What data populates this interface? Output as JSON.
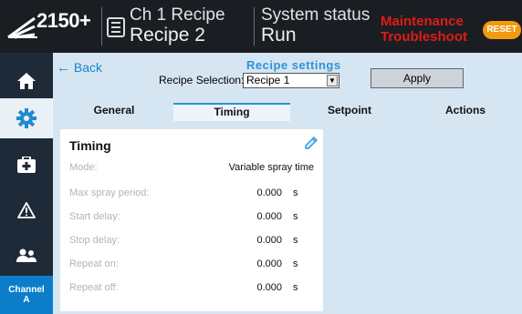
{
  "header": {
    "model": "2150+",
    "recipe_line1": "Ch 1 Recipe",
    "recipe_line2": "Recipe 2",
    "status_line1": "System status",
    "status_line2": "Run",
    "alert_line1": "Maintenance",
    "alert_line2": "Troubleshoot",
    "reset_label": "RESET",
    "alert_color": "#e01c17",
    "reset_color": "#f29a11"
  },
  "sidebar": {
    "items": [
      {
        "name": "home",
        "icon": "home-icon"
      },
      {
        "name": "settings",
        "icon": "gear-icon",
        "active": true
      },
      {
        "name": "maintenance",
        "icon": "first-aid-kit-icon"
      },
      {
        "name": "alarms",
        "icon": "warning-icon"
      },
      {
        "name": "users",
        "icon": "users-icon"
      }
    ],
    "channel_line1": "Channel",
    "channel_line2": "A"
  },
  "page": {
    "back_label": "Back",
    "title": "Recipe settings",
    "recipe_selection_label": "Recipe Selection:",
    "recipe_selection_value": "Recipe 1",
    "apply_label": "Apply"
  },
  "tabs": [
    "General",
    "Timing",
    "Setpoint",
    "Actions"
  ],
  "active_tab": "Timing",
  "card": {
    "title": "Timing",
    "rows": [
      {
        "label": "Mode:",
        "value": "Variable spray time",
        "unit": ""
      },
      {
        "label": "Max spray period:",
        "value": "0.000",
        "unit": "s"
      },
      {
        "label": "Start delay:",
        "value": "0.000",
        "unit": "s"
      },
      {
        "label": "Stop delay:",
        "value": "0.000",
        "unit": "s"
      },
      {
        "label": "Repeat on:",
        "value": "0.000",
        "unit": "s"
      },
      {
        "label": "Repeat off:",
        "value": "0.000",
        "unit": "s"
      }
    ]
  }
}
